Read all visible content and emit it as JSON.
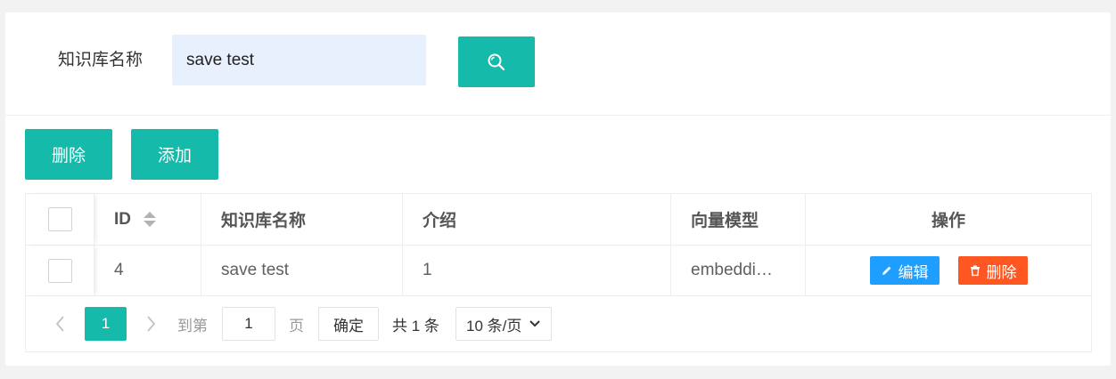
{
  "search": {
    "label": "知识库名称",
    "value": "save test",
    "button_icon": "search-icon"
  },
  "toolbar": {
    "delete_label": "删除",
    "add_label": "添加"
  },
  "table": {
    "columns": [
      "",
      "ID",
      "知识库名称",
      "介绍",
      "向量模型",
      "操作"
    ],
    "rows": [
      {
        "checked": false,
        "id": "4",
        "name": "save test",
        "intro": "1",
        "model": "embeddi…",
        "edit_label": "编辑",
        "delete_label": "删除"
      }
    ]
  },
  "pager": {
    "current_page": "1",
    "goto_label": "到第",
    "goto_value": "1",
    "page_unit": "页",
    "confirm_label": "确定",
    "total_text": "共 1 条",
    "page_size": "10 条/页"
  },
  "colors": {
    "primary": "#16baaa",
    "edit": "#1e9fff",
    "danger": "#ff5722",
    "search_input_bg": "#e8f0fd"
  }
}
